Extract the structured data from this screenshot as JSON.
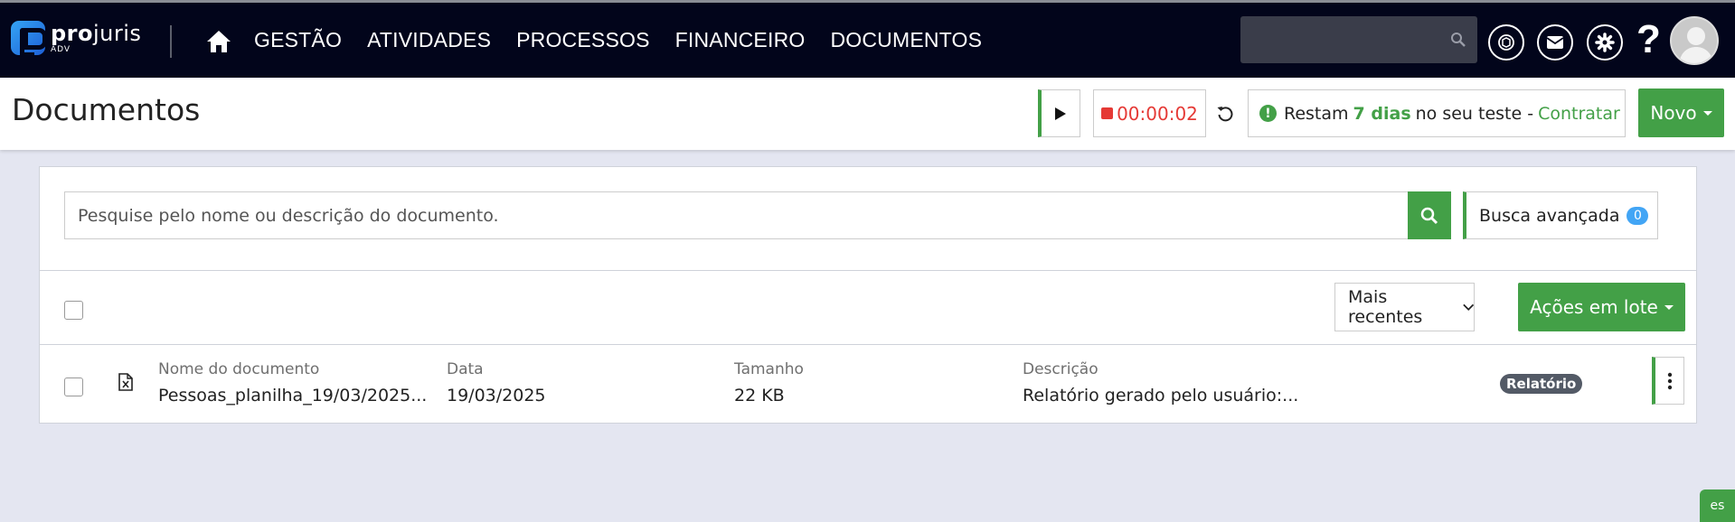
{
  "app": {
    "logo_word": "projuris",
    "logo_bold": "pro",
    "logo_rest": "juris",
    "logo_sub": "ADV"
  },
  "nav": {
    "items": [
      {
        "label": "GESTÃO"
      },
      {
        "label": "ATIVIDADES"
      },
      {
        "label": "PROCESSOS"
      },
      {
        "label": "FINANCEIRO"
      },
      {
        "label": "DOCUMENTOS"
      }
    ],
    "icons": [
      "home-icon",
      "search-icon",
      "ai-icon",
      "mail-icon",
      "gear-icon",
      "help-icon",
      "avatar"
    ]
  },
  "header": {
    "title": "Documentos",
    "timer": "00:00:02",
    "trial_prefix": "Restam",
    "trial_days": "7 dias",
    "trial_suffix": "no seu teste -",
    "trial_link": "Contratar",
    "new_label": "Novo"
  },
  "search": {
    "placeholder": "Pesquise pelo nome ou descrição do documento.",
    "advanced_label": "Busca avançada",
    "advanced_count": "0"
  },
  "list_controls": {
    "sort_label": "Mais recentes",
    "batch_label": "Ações em lote"
  },
  "table": {
    "columns": {
      "name": "Nome do documento",
      "date": "Data",
      "size": "Tamanho",
      "description": "Descrição"
    },
    "rows": [
      {
        "name": "Pessoas_planilha_19/03/2025...",
        "date": "19/03/2025",
        "size": "22 KB",
        "description": "Relatório gerado pelo usuário:...",
        "tag": "Relatório"
      }
    ]
  },
  "side_tab": "es",
  "colors": {
    "navbar": "#02051b",
    "accent_green": "#43a047",
    "timer_red": "#e53935",
    "badge_blue": "#42a5f5",
    "tag_gray": "#535a66",
    "background": "#e4e6f1"
  }
}
